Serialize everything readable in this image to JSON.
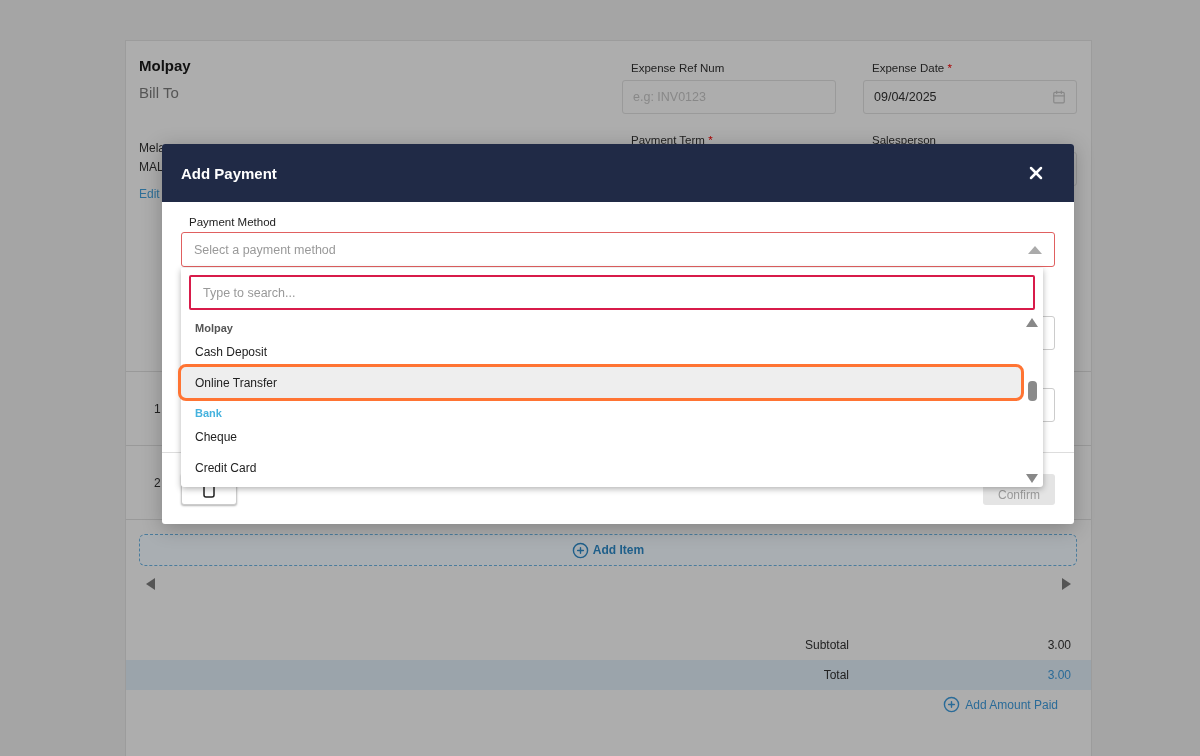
{
  "brand": "Molpay",
  "bill_to": "Bill To",
  "address_lines": [
    "Mela",
    "MAL"
  ],
  "edit_link": "Edit",
  "required_mark": "*",
  "fields": [
    {
      "label": "Expense Ref Num",
      "required": false,
      "placeholder": "e.g: INV0123",
      "kind": "text"
    },
    {
      "label": "Expense Date",
      "required": true,
      "value": "09/04/2025",
      "kind": "date"
    },
    {
      "label": "Payment Term",
      "required": true,
      "kind": "label"
    },
    {
      "label": "Salesperson",
      "required": false,
      "kind": "text"
    }
  ],
  "rows": [
    "1",
    "2"
  ],
  "add_item": "Add Item",
  "totals": [
    {
      "label": "Subtotal",
      "value": "3.00",
      "highlighted": false
    },
    {
      "label": "Total",
      "value": "3.00",
      "highlighted": true
    }
  ],
  "add_amount_paid": "Add Amount Paid",
  "modal": {
    "title": "Add Payment",
    "payment_method": {
      "label": "Payment Method",
      "placeholder": "Select a payment method",
      "expanded": true
    },
    "search": {
      "placeholder": "Type to search..."
    },
    "groups": [
      {
        "name": "Molpay",
        "highlighted": false,
        "items": [
          {
            "label": "Cash Deposit",
            "highlighted": false
          },
          {
            "label": "Online Transfer",
            "highlighted": true
          }
        ]
      },
      {
        "name": "Bank",
        "highlighted": true,
        "items": [
          {
            "label": "Cheque",
            "highlighted": false
          },
          {
            "label": "Credit Card",
            "highlighted": false
          }
        ]
      }
    ],
    "confirm": {
      "label": "Confirm",
      "disabled": true
    }
  }
}
